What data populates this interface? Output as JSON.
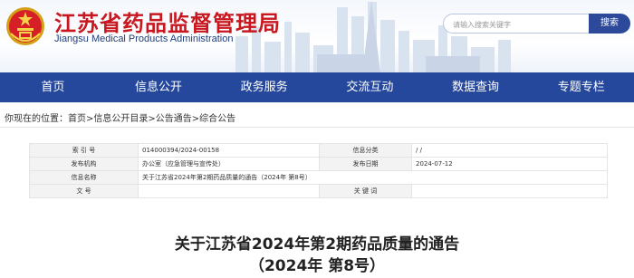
{
  "header": {
    "title_cn": "江苏省药品监督管理局",
    "title_en": "Jiangsu Medical Products Administration",
    "search_placeholder": "请输入搜索关键字",
    "search_button": "搜索"
  },
  "nav": {
    "items": [
      "首页",
      "信息公开",
      "政务服务",
      "交流互动",
      "数据查询",
      "专题专栏"
    ]
  },
  "breadcrumb": {
    "prefix": "你现在的位置：",
    "items": [
      "首页",
      "信息公开目录",
      "公告通告",
      "综合公告"
    ],
    "separator": ">"
  },
  "info": {
    "index_label": "索 引 号",
    "index_value": "014000394/2024-00158",
    "category_label": "信息分类",
    "category_value": "/ /",
    "org_label": "发布机构",
    "org_value": "办公室（应急管理与宣传处）",
    "date_label": "发布日期",
    "date_value": "2024-07-12",
    "name_label": "信息名称",
    "name_value": "关于江苏省2024年第2期药品质量的通告（2024年 第8号）",
    "docno_label": "文 号",
    "docno_value": "",
    "keywords_label": "关 键 词",
    "keywords_value": ""
  },
  "document": {
    "title_line1": "关于江苏省2024年第2期药品质量的通告",
    "title_line2": "（2024年 第8号）"
  },
  "colors": {
    "brand_red": "#c8171e",
    "nav_blue": "#25479c",
    "button_blue": "#2d4a9a"
  }
}
